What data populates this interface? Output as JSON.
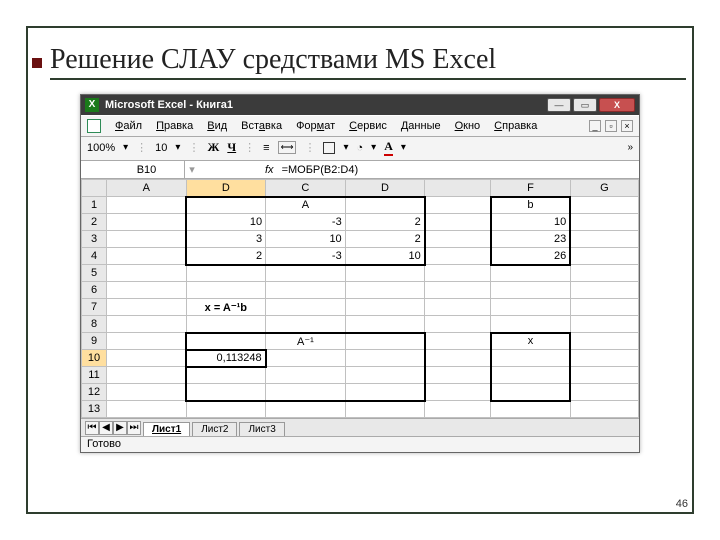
{
  "slide": {
    "title": "Решение СЛАУ средствами MS Excel",
    "page": "46"
  },
  "window": {
    "app_title": "Microsoft Excel - Книга1",
    "menus": {
      "file": "Файл",
      "edit": "Правка",
      "view": "Вид",
      "insert": "Вставка",
      "format": "Формат",
      "tools": "Сервис",
      "data": "Данные",
      "window": "Окно",
      "help": "Справка"
    },
    "toolbar": {
      "zoom": "100%",
      "font_size": "10",
      "bold_glyph": "Ж",
      "under_glyph": "Ч",
      "font_A": "A"
    },
    "namebox": "B10",
    "fx_label": "fx",
    "formula": "=МОБР(B2:D4)"
  },
  "cols": [
    "A",
    "D",
    "C",
    "D",
    "",
    "F",
    "G"
  ],
  "sheet": {
    "A_header": "A",
    "b_header": "b",
    "matrix": [
      [
        10,
        -3,
        2
      ],
      [
        3,
        10,
        2
      ],
      [
        2,
        -3,
        10
      ]
    ],
    "vec_b": [
      10,
      23,
      26
    ],
    "eq_label": "x = A⁻¹b",
    "A_inv_label": "A⁻¹",
    "x_label": "x",
    "sel_value": "0,113248"
  },
  "tabs": {
    "t1": "Лист1",
    "t2": "Лист2",
    "t3": "Лист3"
  },
  "status": "Готово"
}
